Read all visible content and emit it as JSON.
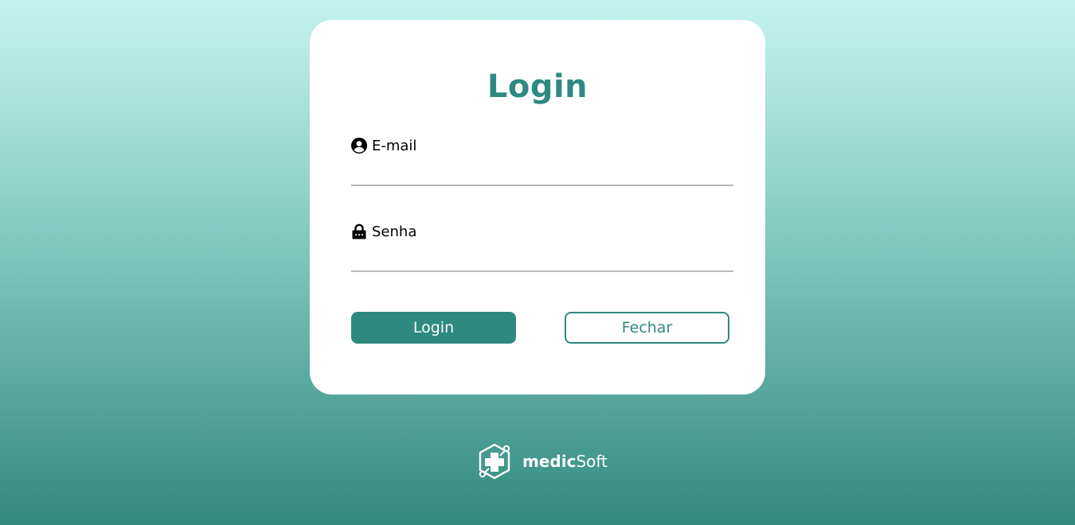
{
  "login_card": {
    "title": "Login",
    "email": {
      "label": "E-mail",
      "value": "",
      "placeholder": ""
    },
    "password": {
      "label": "Senha",
      "value": "",
      "placeholder": ""
    },
    "login_button": "Login",
    "close_button": "Fechar"
  },
  "footer": {
    "brand_bold": "medic",
    "brand_light": "Soft"
  },
  "colors": {
    "accent": "#2e8a80",
    "card_background": "#ffffff",
    "input_underline": "#b8b8b8",
    "gradient_top": "#c3f3ee",
    "gradient_bottom": "#338a80"
  },
  "icons": {
    "email": "user-circle-icon",
    "password": "lock-icon",
    "logo": "medical-cross-logo-icon"
  }
}
